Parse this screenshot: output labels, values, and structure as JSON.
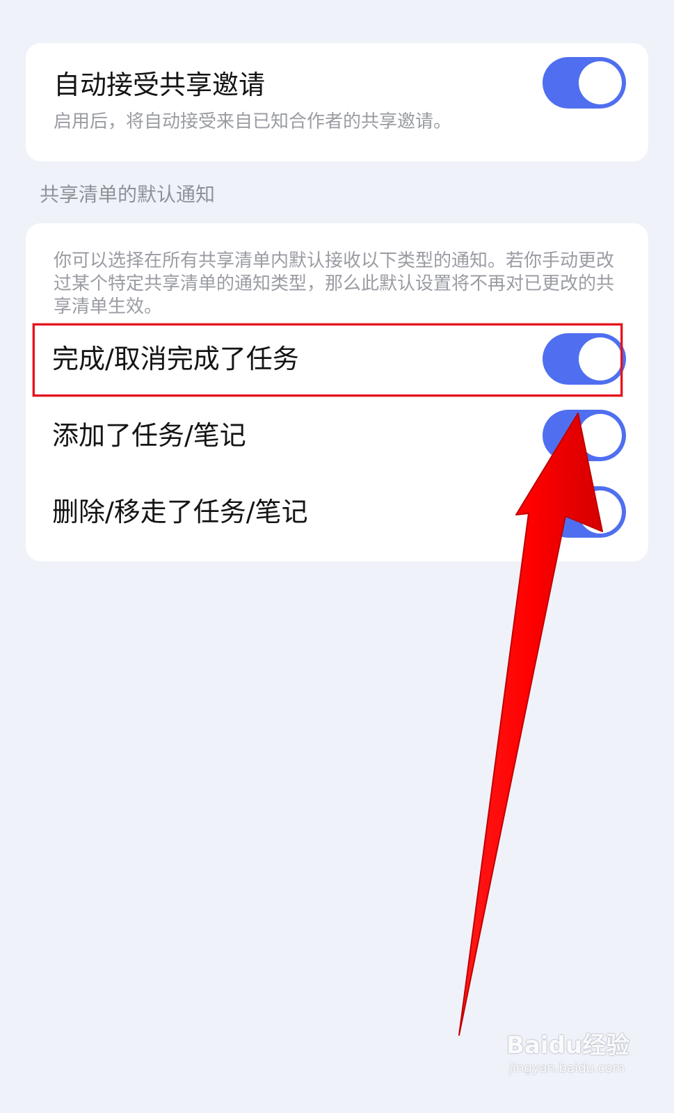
{
  "auto_accept": {
    "title": "自动接受共享邀请",
    "description": "启用后，将自动接受来自已知合作者的共享邀请。",
    "enabled": true
  },
  "section": {
    "label": "共享清单的默认通知",
    "description": "你可以选择在所有共享清单内默认接收以下类型的通知。若你手动更改过某个特定共享清单的通知类型，那么此默认设置将不再对已更改的共享清单生效。"
  },
  "notifications": [
    {
      "label": "完成/取消完成了任务",
      "enabled": true
    },
    {
      "label": "添加了任务/笔记",
      "enabled": true
    },
    {
      "label": "删除/移走了任务/笔记",
      "enabled": true
    }
  ],
  "watermark": {
    "logo": "Baidu经验",
    "url": "jingyan.baidu.com"
  },
  "colors": {
    "toggle_on": "#4f6ff0",
    "highlight": "#e3141c",
    "arrow": "#ff0a0a",
    "background": "#f0f2fa"
  }
}
